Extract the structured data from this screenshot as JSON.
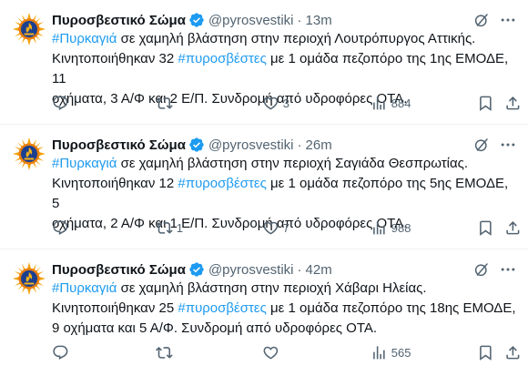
{
  "colors": {
    "accent": "#1d9bf0",
    "muted": "#536471",
    "text": "#0f1419",
    "verified_badge": "#1d9bf0"
  },
  "icons": {
    "avatar": "fire-service-emblem",
    "verified": "verified-badge-icon",
    "grok": "grok-icon",
    "more": "more-options-icon",
    "reply": "reply-icon",
    "retweet": "retweet-icon",
    "like": "like-icon",
    "views": "views-icon",
    "bookmark": "bookmark-icon",
    "share": "share-icon"
  },
  "tweets": [
    {
      "author_name": "Πυροσβεστικό Σώμα",
      "handle": "@pyrosvestiki",
      "separator": "·",
      "time": "13m",
      "line1_pre": "",
      "line1_tag": "#Πυρκαγιά",
      "line1_post": " σε χαμηλή βλάστηση στην περιοχή Λουτρόπυργος Αττικής.",
      "line2_pre": "Κινητοποιήθηκαν 32 ",
      "line2_tag": "#πυροσβέστες",
      "line2_post": " με 1 ομάδα πεζοπόρο της 1ης ΕΜΟΔΕ, 11",
      "line3": "οχήματα, 3 Α/Φ και 2 Ε/Π. Συνδρομή από υδροφόρες ΟΤΑ.",
      "replies": "",
      "retweets": "",
      "likes": "3",
      "views": "884"
    },
    {
      "author_name": "Πυροσβεστικό Σώμα",
      "handle": "@pyrosvestiki",
      "separator": "·",
      "time": "26m",
      "line1_pre": "",
      "line1_tag": "#Πυρκαγιά",
      "line1_post": " σε χαμηλή βλάστηση στην περιοχή Σαγιάδα Θεσπρωτίας.",
      "line2_pre": "Κινητοποιήθηκαν 12 ",
      "line2_tag": "#πυροσβέστες",
      "line2_post": " με 1 ομάδα πεζοπόρο της 5ης ΕΜΟΔΕ, 5",
      "line3": "οχήματα, 2 Α/Φ και 1 Ε/Π. Συνδρομή από υδροφόρες ΟΤΑ.",
      "replies": "",
      "retweets": "1",
      "likes": "7",
      "views": "988"
    },
    {
      "author_name": "Πυροσβεστικό Σώμα",
      "handle": "@pyrosvestiki",
      "separator": "·",
      "time": "42m",
      "line1_pre": "",
      "line1_tag": "#Πυρκαγιά",
      "line1_post": " σε χαμηλή βλάστηση στην περιοχή Χάβαρι Ηλείας.",
      "line2_pre": "Κινητοποιήθηκαν 25 ",
      "line2_tag": "#πυροσβέστες",
      "line2_post": " με 1 ομάδα πεζοπόρο της 18ης ΕΜΟΔΕ,",
      "line3": "9 οχήματα και 5 Α/Φ. Συνδρομή από υδροφόρες ΟΤΑ.",
      "replies": "",
      "retweets": "",
      "likes": "",
      "views": "565"
    }
  ]
}
